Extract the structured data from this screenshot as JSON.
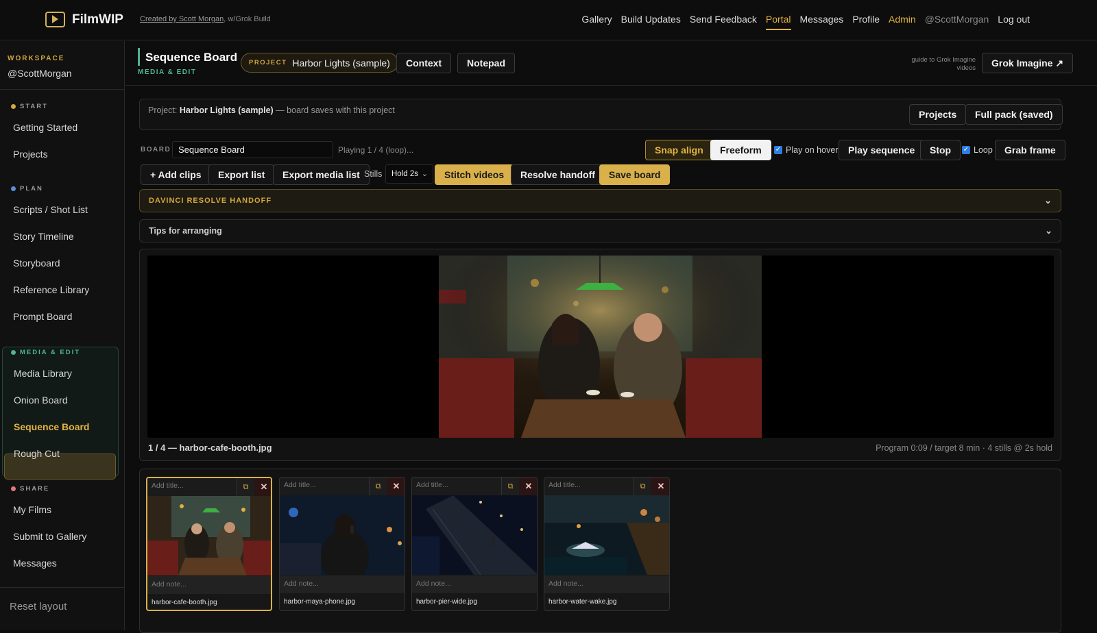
{
  "app": {
    "name": "FilmWIP",
    "credit_link": "Created by Scott Morgan",
    "credit_rest": ", w/Grok Build"
  },
  "nav": {
    "items": [
      "Gallery",
      "Build Updates",
      "Send Feedback",
      "Portal",
      "Messages",
      "Profile",
      "Admin",
      "@ScottMorgan",
      "Log out"
    ],
    "active": "Portal"
  },
  "sidebar": {
    "workspace_label": "WORKSPACE",
    "user": "@ScottMorgan",
    "sections": [
      {
        "label": "START",
        "color": "#d4a73e",
        "items": [
          "Getting Started",
          "Projects"
        ]
      },
      {
        "label": "PLAN",
        "color": "#5b8fd6",
        "items": [
          "Scripts / Shot List",
          "Story Timeline",
          "Storyboard",
          "Reference Library",
          "Prompt Board"
        ]
      },
      {
        "label": "MEDIA & EDIT",
        "color": "#4fb58f",
        "items": [
          "Media Library",
          "Onion Board",
          "Sequence Board",
          "Rough Cut"
        ]
      },
      {
        "label": "SHARE",
        "color": "#e07a7a",
        "items": [
          "My Films",
          "Submit to Gallery",
          "Messages"
        ]
      }
    ],
    "reset": "Reset layout"
  },
  "header": {
    "title": "Sequence Board",
    "subtitle": "MEDIA & EDIT",
    "project_key": "PROJECT",
    "project_name": "Harbor Lights (sample)",
    "context_btn": "Context",
    "notepad_btn": "Notepad",
    "guide_text": "guide to Grok Imagine videos",
    "grok_btn": "Grok Imagine ↗"
  },
  "project_card": {
    "prefix": "Project:",
    "name": "Harbor Lights (sample)",
    "suffix": "— board saves with this project",
    "projects_btn": "Projects",
    "fullpack_btn": "Full pack (saved)"
  },
  "board": {
    "label": "BOARD",
    "name": "Sequence Board",
    "status": "Playing 1 / 4 (loop)...",
    "snap_btn": "Snap align",
    "freeform_btn": "Freeform",
    "play_on_hover": "Play on hover",
    "play_seq_btn": "Play sequence",
    "stop_btn": "Stop",
    "loop": "Loop",
    "grab_btn": "Grab frame"
  },
  "toolbar": {
    "add_clips": "+ Add clips",
    "export_list": "Export list",
    "export_media": "Export media list",
    "stills_label": "Stills",
    "stills_value": "Hold 2s",
    "stitch": "Stitch videos",
    "resolve": "Resolve handoff",
    "save": "Save board"
  },
  "accordions": {
    "resolve": "DAVINCI RESOLVE HANDOFF",
    "tips": "Tips for arranging"
  },
  "viewer": {
    "caption": "1 / 4 — harbor-cafe-booth.jpg",
    "stats": "Program 0:09 / target 8 min · 4 stills @ 2s hold"
  },
  "clips": [
    {
      "title_ph": "Add title...",
      "note_ph": "Add note...",
      "file": "harbor-cafe-booth.jpg",
      "selected": true
    },
    {
      "title_ph": "Add title...",
      "note_ph": "Add note...",
      "file": "harbor-maya-phone.jpg",
      "selected": false
    },
    {
      "title_ph": "Add title...",
      "note_ph": "Add note...",
      "file": "harbor-pier-wide.jpg",
      "selected": false
    },
    {
      "title_ph": "Add title...",
      "note_ph": "Add note...",
      "file": "harbor-water-wake.jpg",
      "selected": false
    }
  ],
  "icons": {
    "copy": "copy-icon",
    "delete": "close-icon",
    "chevron": "chevron-down-icon",
    "logo": "film-icon"
  },
  "colors": {
    "accent": "#d9b04a",
    "media_edit": "#4fb58f",
    "checkbox": "#2f7de1"
  }
}
